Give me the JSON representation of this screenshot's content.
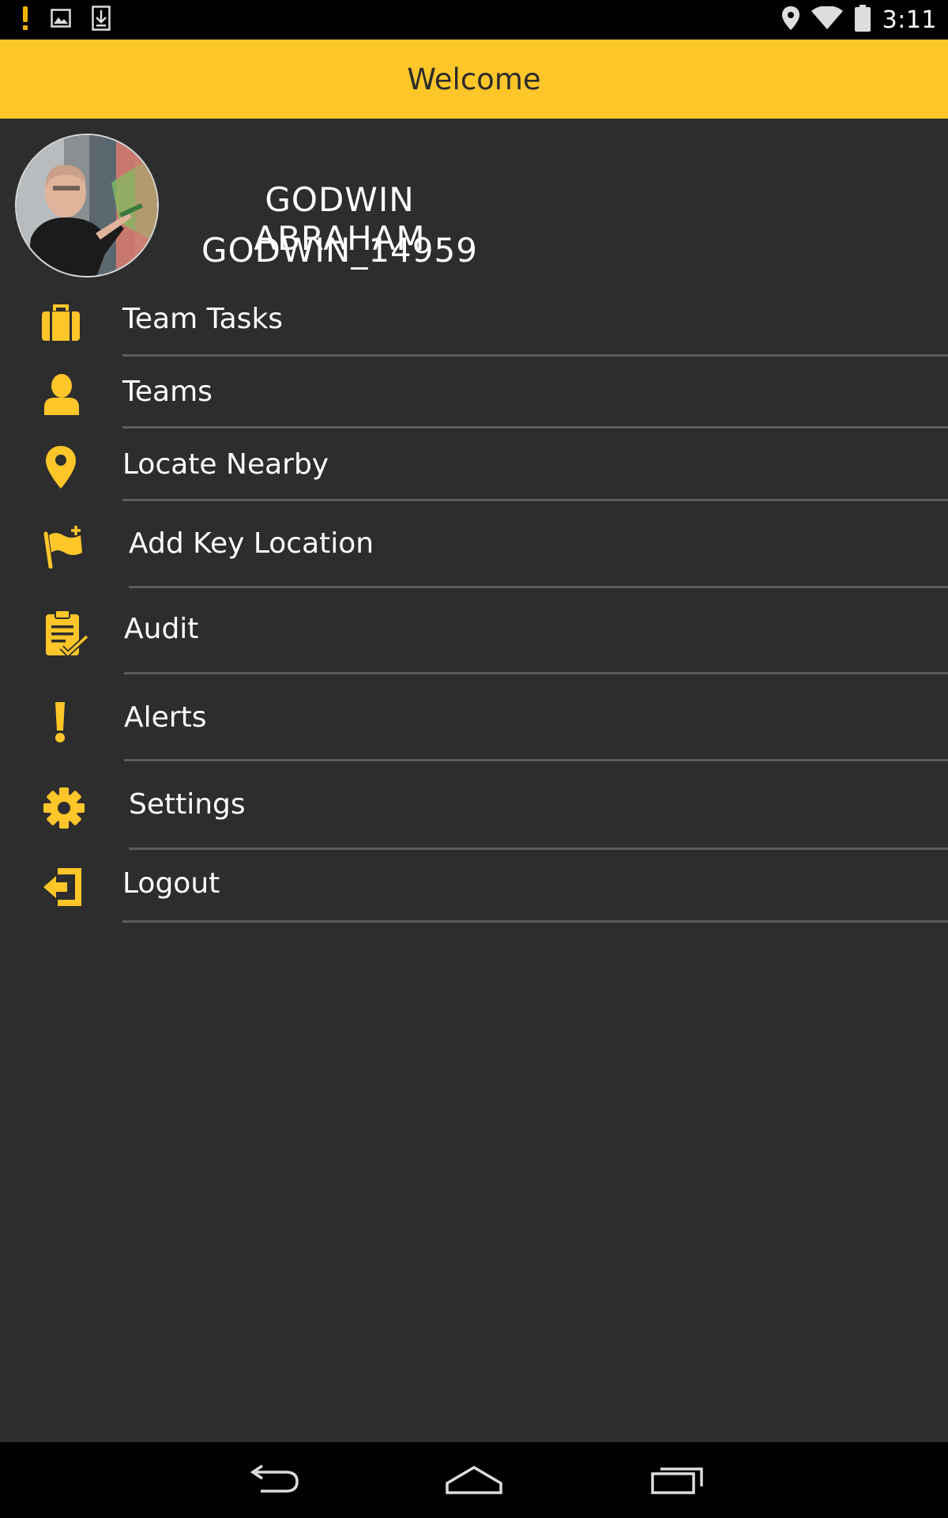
{
  "status_bar": {
    "time": "3:11",
    "left_icons": [
      "alert-icon",
      "image-icon",
      "download-icon"
    ],
    "right_icons": [
      "location-icon",
      "wifi-icon",
      "battery-icon"
    ]
  },
  "header": {
    "title": "Welcome"
  },
  "profile": {
    "name": "GODWIN ABRAHAM",
    "user_id": "GODWIN_14959"
  },
  "menu": {
    "items": [
      {
        "label": "Team Tasks",
        "icon": "briefcase-icon"
      },
      {
        "label": "Teams",
        "icon": "person-icon"
      },
      {
        "label": "Locate Nearby",
        "icon": "map-pin-icon"
      },
      {
        "label": "Add Key Location",
        "icon": "flag-add-icon"
      },
      {
        "label": "Audit",
        "icon": "clipboard-check-icon"
      },
      {
        "label": "Alerts",
        "icon": "exclamation-icon"
      },
      {
        "label": "Settings",
        "icon": "gear-icon"
      },
      {
        "label": "Logout",
        "icon": "logout-icon"
      }
    ]
  },
  "nav_bar": {
    "buttons": [
      "back-icon",
      "home-icon",
      "recents-icon"
    ]
  },
  "colors": {
    "accent": "#ffc629",
    "background": "#2d2d2d",
    "separator": "#5c5c5c",
    "text": "#ffffff"
  }
}
